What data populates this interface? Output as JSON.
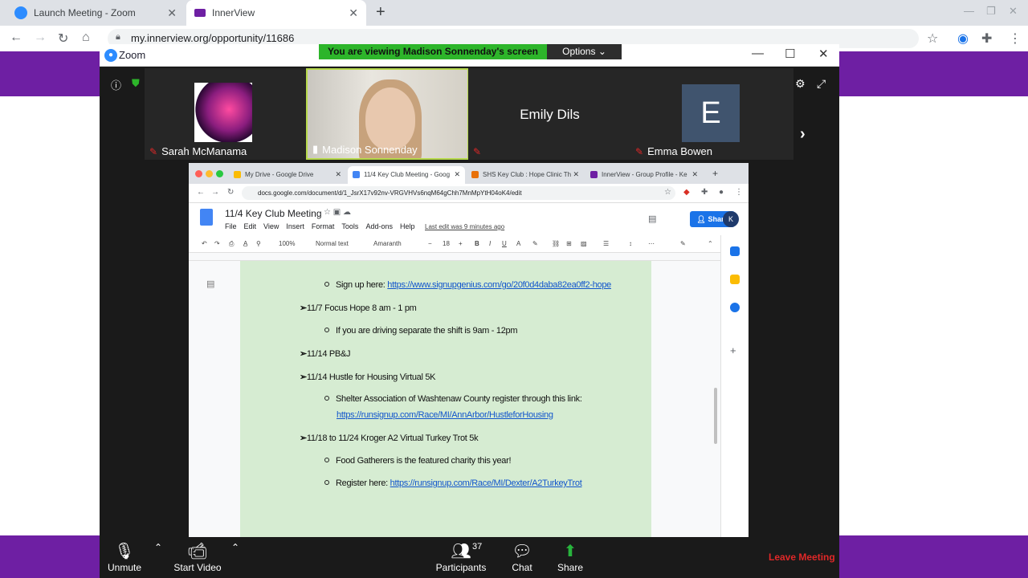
{
  "browser": {
    "tabs": [
      {
        "label": "Launch Meeting - Zoom",
        "active": false
      },
      {
        "label": "InnerView",
        "active": true
      }
    ],
    "url": "my.innerview.org/opportunity/11686"
  },
  "zoom": {
    "window_title": "Zoom",
    "banner": "You are viewing Madison Sonnenday's screen",
    "options_label": "Options",
    "participants": [
      {
        "name": "Sarah McManama",
        "type": "image"
      },
      {
        "name": "Madison Sonnenday",
        "type": "video"
      },
      {
        "name": "Emily Dils",
        "type": "name"
      },
      {
        "name": "Emma Bowen",
        "type": "avatar",
        "initial": "E"
      }
    ],
    "controls": {
      "unmute": "Unmute",
      "start_video": "Start Video",
      "participants": "Participants",
      "participant_count": "37",
      "chat": "Chat",
      "share": "Share",
      "leave": "Leave Meeting"
    },
    "colors": {
      "banner": "#2db52a",
      "leave": "#e02828",
      "active_border": "#b6d94b",
      "share_icon": "#28b43d"
    }
  },
  "shared_screen": {
    "tabs": [
      {
        "label": "My Drive - Google Drive"
      },
      {
        "label": "11/4 Key Club Meeting - Goog"
      },
      {
        "label": "SHS Key Club : Hope Clinic Th"
      },
      {
        "label": "InnerView - Group Profile - Ke"
      }
    ],
    "url": "docs.google.com/document/d/1_JsrX17v92nv-VRGVHVs6nqM64gChh7MnMpYtH04oK4/edit",
    "doc": {
      "title": "11/4 Key Club Meeting",
      "menu": [
        "File",
        "Edit",
        "View",
        "Insert",
        "Format",
        "Tools",
        "Add-ons",
        "Help"
      ],
      "last_edit": "Last edit was 9 minutes ago",
      "share_label": "Share",
      "avatar_initial": "K",
      "toolbar": {
        "zoom": "100%",
        "style": "Normal text",
        "font": "Amaranth",
        "size": "18"
      },
      "lines": [
        {
          "kind": "bullet",
          "text": "Sign up here: ",
          "link": "https://www.signupgenius.com/go/20f0d4daba82ea0ff2-hope"
        },
        {
          "kind": "arrow",
          "text": "11/7 Focus Hope 8 am - 1 pm"
        },
        {
          "kind": "bullet",
          "text": "If you are driving separate the shift is 9am - 12pm"
        },
        {
          "kind": "arrow",
          "text": "11/14 PB&J"
        },
        {
          "kind": "arrow",
          "text": "11/14 Hustle for Housing Virtual 5K"
        },
        {
          "kind": "bullet",
          "text": "Shelter Association of Washtenaw County register through this link:"
        },
        {
          "kind": "link_only",
          "link": "https://runsignup.com/Race/MI/AnnArbor/HustleforHousing"
        },
        {
          "kind": "arrow",
          "text": "11/18 to 11/24 Kroger A2 Virtual Turkey Trot 5k"
        },
        {
          "kind": "bullet",
          "text": "Food Gatherers is the featured charity this year!"
        },
        {
          "kind": "bullet",
          "text": "Register here: ",
          "link": "https://runsignup.com/Race/MI/Dexter/A2TurkeyTrot"
        }
      ],
      "page_color": "#d6ecd2"
    }
  }
}
